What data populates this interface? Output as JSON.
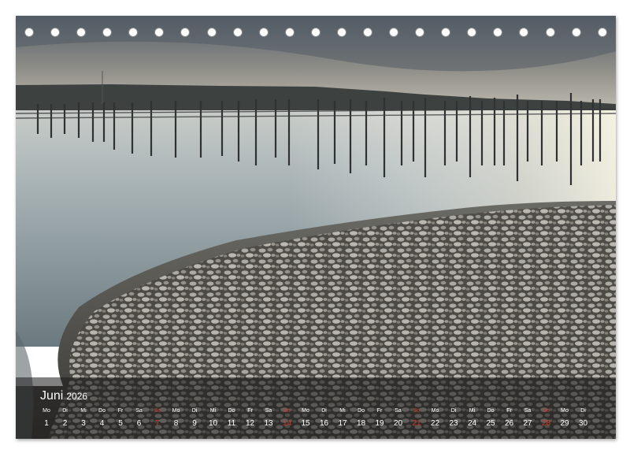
{
  "calendar": {
    "month": "Juni",
    "year": "2026",
    "days": [
      {
        "wd": "Mo",
        "d": "1",
        "sunday": false
      },
      {
        "wd": "Di",
        "d": "2",
        "sunday": false
      },
      {
        "wd": "Mi",
        "d": "3",
        "sunday": false
      },
      {
        "wd": "Do",
        "d": "4",
        "sunday": false
      },
      {
        "wd": "Fr",
        "d": "5",
        "sunday": false
      },
      {
        "wd": "Sa",
        "d": "6",
        "sunday": false
      },
      {
        "wd": "So",
        "d": "7",
        "sunday": true
      },
      {
        "wd": "Mo",
        "d": "8",
        "sunday": false
      },
      {
        "wd": "Di",
        "d": "9",
        "sunday": false
      },
      {
        "wd": "Mi",
        "d": "10",
        "sunday": false
      },
      {
        "wd": "Do",
        "d": "11",
        "sunday": false
      },
      {
        "wd": "Fr",
        "d": "12",
        "sunday": false
      },
      {
        "wd": "Sa",
        "d": "13",
        "sunday": false
      },
      {
        "wd": "So",
        "d": "14",
        "sunday": true
      },
      {
        "wd": "Mo",
        "d": "15",
        "sunday": false
      },
      {
        "wd": "Di",
        "d": "16",
        "sunday": false
      },
      {
        "wd": "Mi",
        "d": "17",
        "sunday": false
      },
      {
        "wd": "Do",
        "d": "18",
        "sunday": false
      },
      {
        "wd": "Fr",
        "d": "19",
        "sunday": false
      },
      {
        "wd": "Sa",
        "d": "20",
        "sunday": false
      },
      {
        "wd": "So",
        "d": "21",
        "sunday": true
      },
      {
        "wd": "Mo",
        "d": "22",
        "sunday": false
      },
      {
        "wd": "Di",
        "d": "23",
        "sunday": false
      },
      {
        "wd": "Mi",
        "d": "24",
        "sunday": false
      },
      {
        "wd": "Do",
        "d": "25",
        "sunday": false
      },
      {
        "wd": "Fr",
        "d": "26",
        "sunday": false
      },
      {
        "wd": "Sa",
        "d": "27",
        "sunday": false
      },
      {
        "wd": "So",
        "d": "28",
        "sunday": true
      },
      {
        "wd": "Mo",
        "d": "29",
        "sunday": false
      },
      {
        "wd": "Di",
        "d": "30",
        "sunday": false
      }
    ]
  },
  "colors": {
    "sunday": "#d23b2b",
    "text": "#ffffff",
    "bar": "#191919"
  },
  "binding_holes": 23
}
